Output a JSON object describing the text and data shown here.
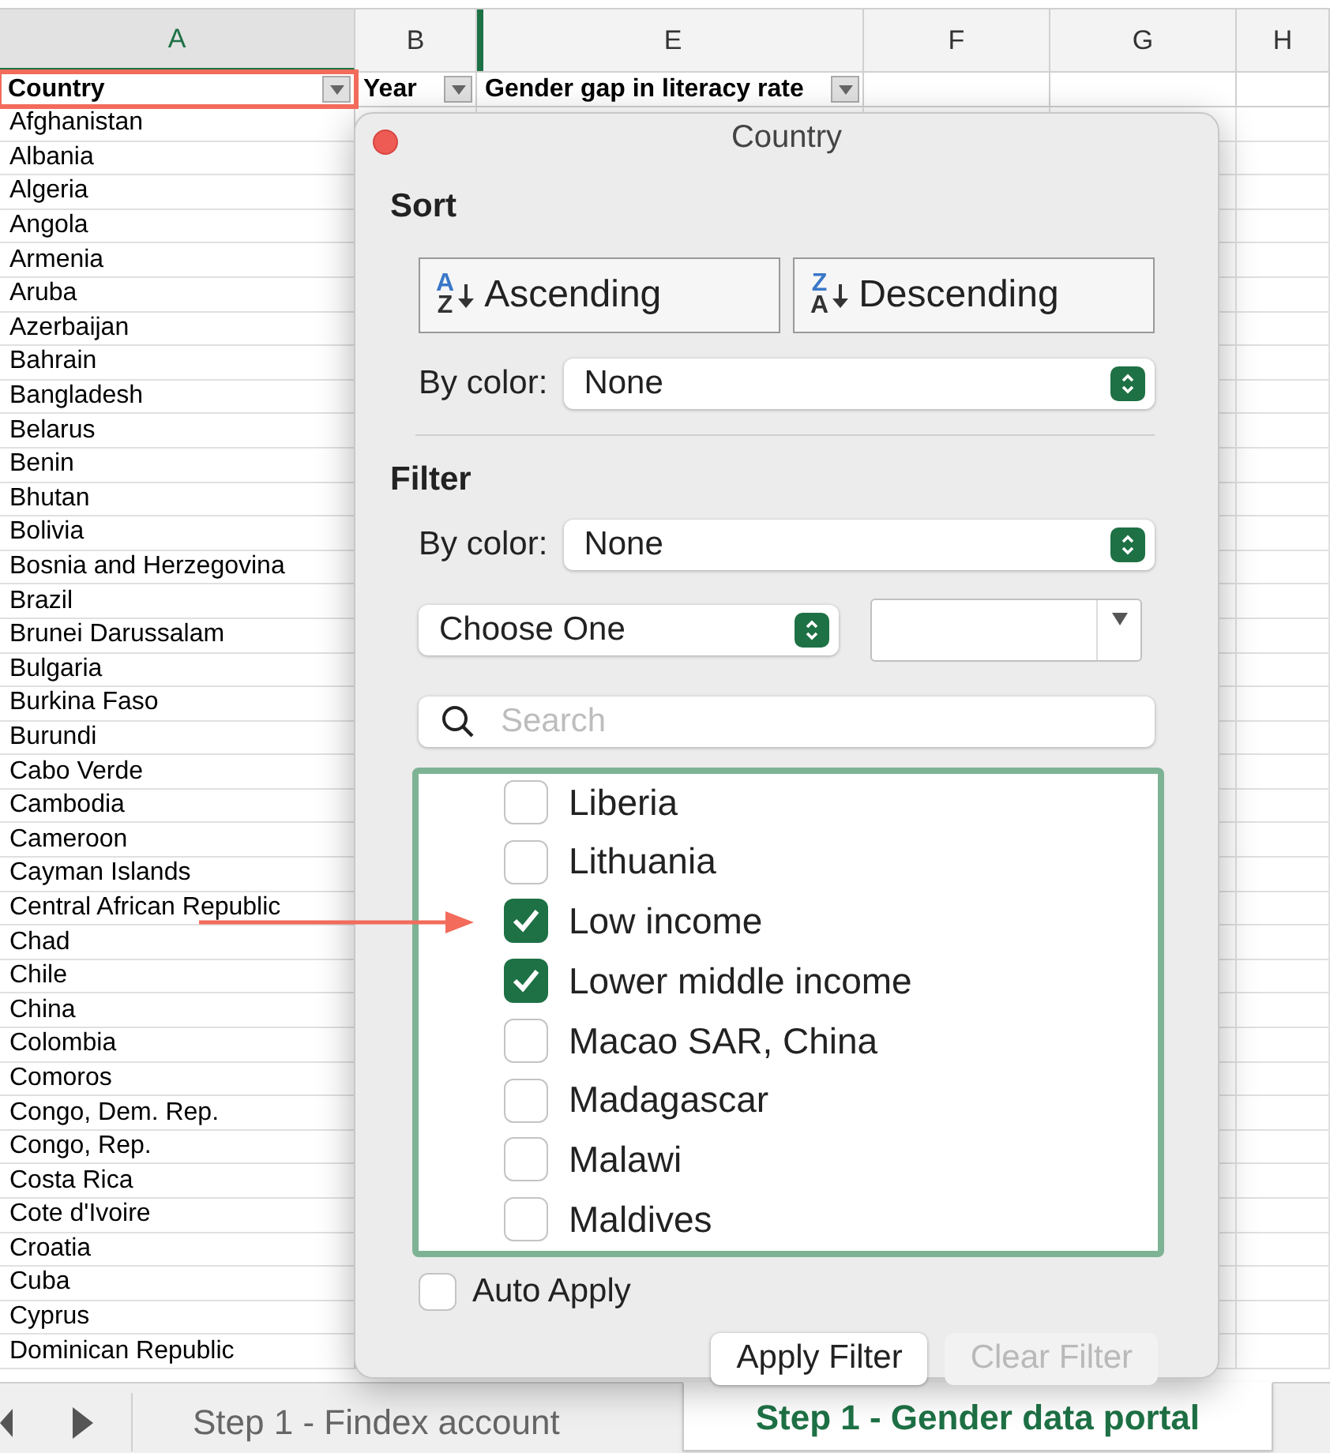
{
  "columns": [
    {
      "label": "A",
      "selected": true
    },
    {
      "label": "B",
      "selected": false
    },
    {
      "label": "E",
      "selected": false
    },
    {
      "label": "F",
      "selected": false
    },
    {
      "label": "G",
      "selected": false
    },
    {
      "label": "H",
      "selected": false
    }
  ],
  "header_row": [
    {
      "text": "Country",
      "highlighted": true
    },
    {
      "text": "Year",
      "highlighted": false
    },
    {
      "text": "Gender gap in literacy rate",
      "highlighted": false
    }
  ],
  "rows": [
    "Afghanistan",
    "Albania",
    "Algeria",
    "Angola",
    "Armenia",
    "Aruba",
    "Azerbaijan",
    "Bahrain",
    "Bangladesh",
    "Belarus",
    "Benin",
    "Bhutan",
    "Bolivia",
    "Bosnia and Herzegovina",
    "Brazil",
    "Brunei Darussalam",
    "Bulgaria",
    "Burkina Faso",
    "Burundi",
    "Cabo Verde",
    "Cambodia",
    "Cameroon",
    "Cayman Islands",
    "Central African Republic",
    "Chad",
    "Chile",
    "China",
    "Colombia",
    "Comoros",
    "Congo, Dem. Rep.",
    "Congo, Rep.",
    "Costa Rica",
    "Cote d'Ivoire",
    "Croatia",
    "Cuba",
    "Cyprus",
    "Dominican Republic"
  ],
  "filter_dialog": {
    "title": "Country",
    "sort": {
      "heading": "Sort",
      "buttons": [
        {
          "label": "Ascending",
          "top": "A",
          "bottom": "Z"
        },
        {
          "label": "Descending",
          "top": "Z",
          "bottom": "A"
        }
      ],
      "by_color_label": "By color:",
      "by_color_value": "None"
    },
    "filter": {
      "heading": "Filter",
      "by_color_label": "By color:",
      "by_color_value": "None",
      "condition": "Choose One",
      "search_placeholder": "Search",
      "items": [
        {
          "label": "Liberia",
          "checked": false
        },
        {
          "label": "Lithuania",
          "checked": false
        },
        {
          "label": "Low income",
          "checked": true
        },
        {
          "label": "Lower middle income",
          "checked": true
        },
        {
          "label": "Macao SAR, China",
          "checked": false
        },
        {
          "label": "Madagascar",
          "checked": false
        },
        {
          "label": "Malawi",
          "checked": false
        },
        {
          "label": "Maldives",
          "checked": false
        }
      ],
      "auto_apply": {
        "label": "Auto Apply",
        "checked": false
      },
      "buttons": [
        {
          "label": "Apply Filter",
          "disabled": false
        },
        {
          "label": "Clear Filter",
          "disabled": true
        }
      ]
    }
  },
  "sheet_tabs": [
    {
      "label": "Step 1 - Findex account",
      "selected": false
    },
    {
      "label": "Step 1 - Gender data portal",
      "selected": true
    }
  ]
}
